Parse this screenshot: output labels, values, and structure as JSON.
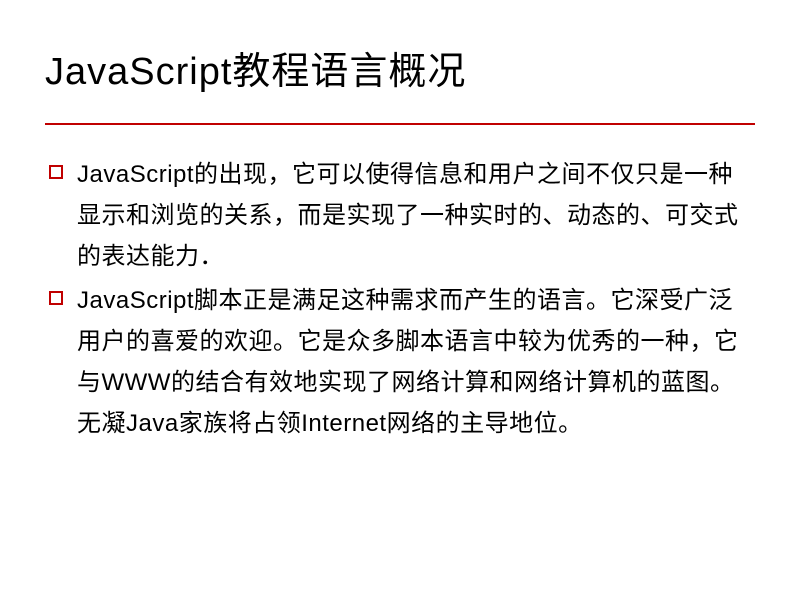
{
  "slide": {
    "title": "JavaScript教程语言概况",
    "bullets": [
      "JavaScript的出现，它可以使得信息和用户之间不仅只是一种显示和浏览的关系，而是实现了一种实时的、动态的、可交式的表达能力．",
      "JavaScript脚本正是满足这种需求而产生的语言。它深受广泛用户的喜爱的欢迎。它是众多脚本语言中较为优秀的一种，它与WWW的结合有效地实现了网络计算和网络计算机的蓝图。无凝Java家族将占领Internet网络的主导地位。"
    ]
  }
}
